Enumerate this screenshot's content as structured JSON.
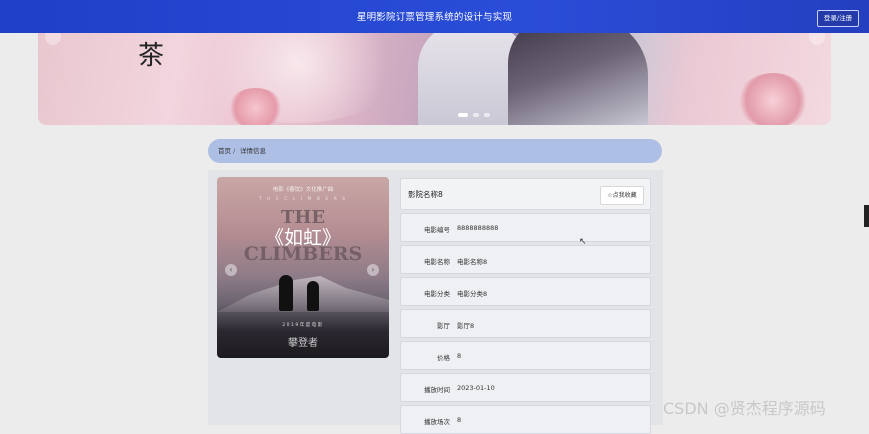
{
  "header": {
    "title": "星明影院订票管理系统的设计与实现",
    "login_label": "登录/注册"
  },
  "breadcrumb": {
    "home": "首页",
    "separator": "/",
    "current": "详情信息"
  },
  "poster": {
    "top_line": "电影《春饮》文化推广曲",
    "sub_line": "T H E C L I M B E R S",
    "title_en_1": "THE",
    "title_en_2": "CLIMBERS",
    "title_cn": "《如虹》",
    "bottom_line": "2019年度电影",
    "footer_text": "攀登者"
  },
  "detail": {
    "cinema_name": "影院名称8",
    "favorite_label": "☆点我收藏",
    "fields": [
      {
        "label": "电影编号",
        "value": "8888888888"
      },
      {
        "label": "电影名称",
        "value": "电影名称8"
      },
      {
        "label": "电影分类",
        "value": "电影分类8"
      },
      {
        "label": "影厅",
        "value": "影厅8"
      },
      {
        "label": "价格",
        "value": "8"
      },
      {
        "label": "播放时间",
        "value": "2023-01-10"
      },
      {
        "label": "播放场次",
        "value": "8"
      }
    ]
  },
  "watermark": "CSDN @贤杰程序源码",
  "colors": {
    "header_bg": "#2a4dd8",
    "breadcrumb_bg": "#aebfe5"
  }
}
